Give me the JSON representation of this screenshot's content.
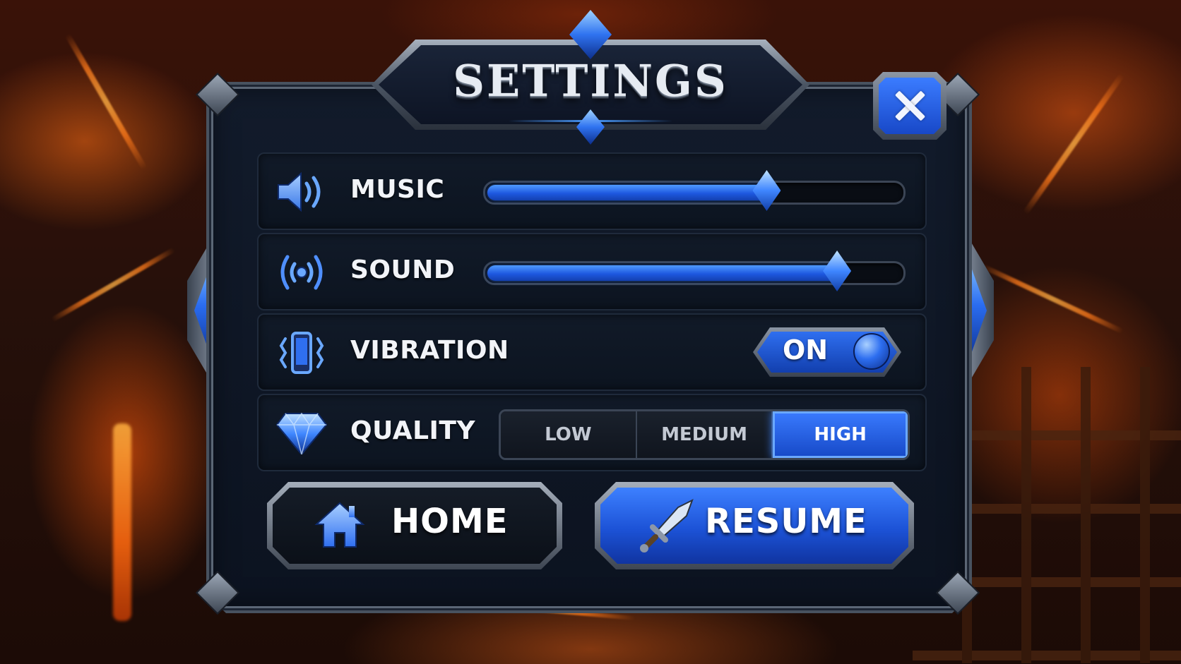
{
  "dialog": {
    "title": "SETTINGS",
    "close_icon": "close-icon"
  },
  "settings": {
    "music": {
      "label": "MUSIC",
      "icon": "speaker-icon",
      "value": 0.68
    },
    "sound": {
      "label": "SOUND",
      "icon": "sound-waves-icon",
      "value": 0.85
    },
    "vibration": {
      "label": "VIBRATION",
      "icon": "phone-vibrate-icon",
      "state": "ON"
    },
    "quality": {
      "label": "QUALITY",
      "icon": "diamond-icon",
      "options": [
        "LOW",
        "MEDIUM",
        "HIGH"
      ],
      "selected": "HIGH"
    }
  },
  "buttons": {
    "home": {
      "label": "HOME",
      "icon": "house-icon"
    },
    "resume": {
      "label": "RESUME",
      "icon": "sword-icon"
    }
  },
  "colors": {
    "accent": "#2f6ff0",
    "frame": "#5b6675",
    "panel": "#0f1725",
    "lava": "#ff7a1a"
  }
}
